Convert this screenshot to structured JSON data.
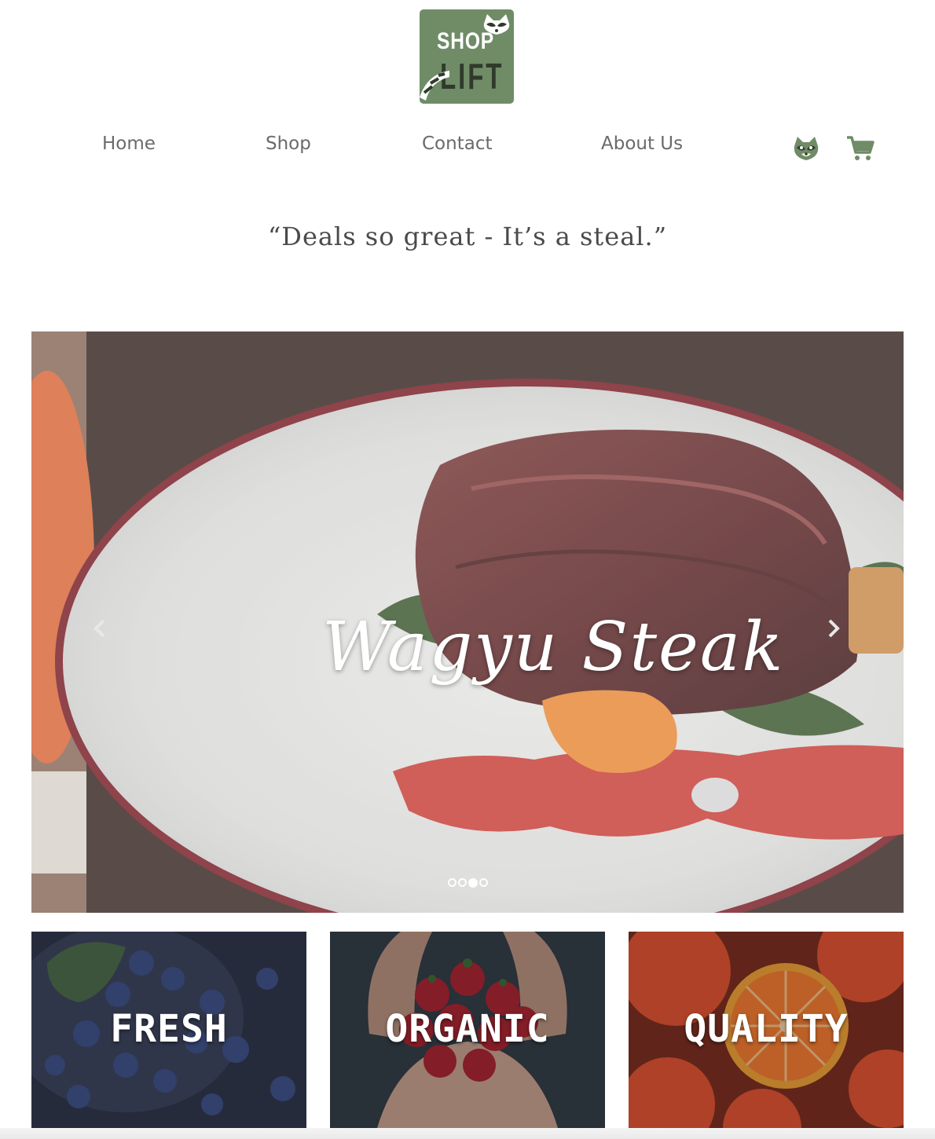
{
  "brand": {
    "logo_top": "SHOP",
    "logo_bottom": "LIFT",
    "accent_color": "#6f8c66"
  },
  "nav": {
    "items": [
      {
        "label": "Home"
      },
      {
        "label": "Shop"
      },
      {
        "label": "Contact"
      },
      {
        "label": "About Us"
      }
    ],
    "account_icon": "raccoon-icon",
    "cart_icon": "cart-icon"
  },
  "tagline": "“Deals so great - It’s a steal.”",
  "carousel": {
    "caption": "Wagyu Steak",
    "prev_icon": "chevron-left-icon",
    "next_icon": "chevron-right-icon",
    "slide_count": 4,
    "active_index": 2
  },
  "features": [
    {
      "label": "FRESH"
    },
    {
      "label": "ORGANIC"
    },
    {
      "label": "QUALITY"
    }
  ]
}
